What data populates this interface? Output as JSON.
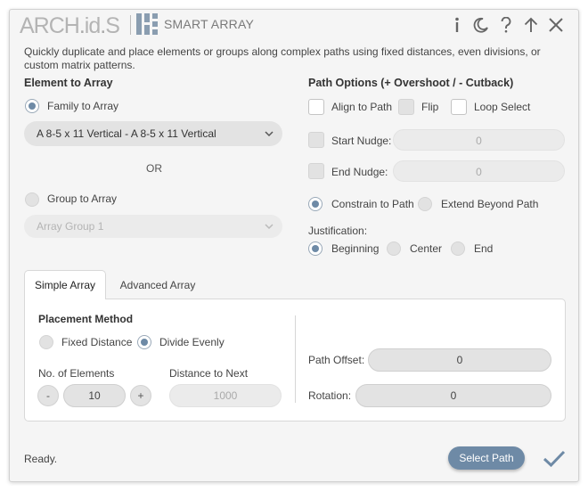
{
  "titlebar": {
    "logo_main": "ARCH",
    "logo_mid": "id",
    "logo_end": "S",
    "app_title": "SMART ARRAY",
    "icons": [
      "info-icon",
      "moon-icon",
      "help-icon",
      "up-arrow-icon",
      "close-icon"
    ]
  },
  "description": "Quickly duplicate and place elements or groups along complex paths using fixed distances, even divisions, or custom matrix patterns.",
  "element_to_array": {
    "title": "Element to Array",
    "family_label": "Family to Array",
    "family_selected": true,
    "family_value": "A 8-5 x 11 Vertical - A 8-5 x 11 Vertical",
    "or_label": "OR",
    "group_label": "Group to Array",
    "group_selected": false,
    "group_value": "Array Group 1"
  },
  "path_options": {
    "title": "Path Options (+ Overshoot / - Cutback)",
    "align_label": "Align to Path",
    "flip_label": "Flip",
    "loop_label": "Loop Select",
    "start_nudge_label": "Start Nudge:",
    "start_nudge_value": "0",
    "end_nudge_label": "End Nudge:",
    "end_nudge_value": "0",
    "constrain_label": "Constrain to Path",
    "extend_label": "Extend Beyond Path",
    "justification_label": "Justification:",
    "just_beginning": "Beginning",
    "just_center": "Center",
    "just_end": "End"
  },
  "tabs": {
    "simple": "Simple Array",
    "advanced": "Advanced Array"
  },
  "simple_array": {
    "placement_title": "Placement Method",
    "fixed_distance_label": "Fixed Distance",
    "divide_evenly_label": "Divide Evenly",
    "num_elements_label": "No. of Elements",
    "num_elements_value": "10",
    "minus_label": "-",
    "plus_label": "+",
    "distance_label": "Distance to Next",
    "distance_value": "1000",
    "path_offset_label": "Path Offset:",
    "path_offset_value": "0",
    "rotation_label": "Rotation:",
    "rotation_value": "0"
  },
  "footer": {
    "status": "Ready.",
    "select_path_label": "Select Path"
  },
  "colors": {
    "accent": "#6e8aa6",
    "panel_bg": "#f5f5f5",
    "field_bg": "#e3e3e3"
  }
}
